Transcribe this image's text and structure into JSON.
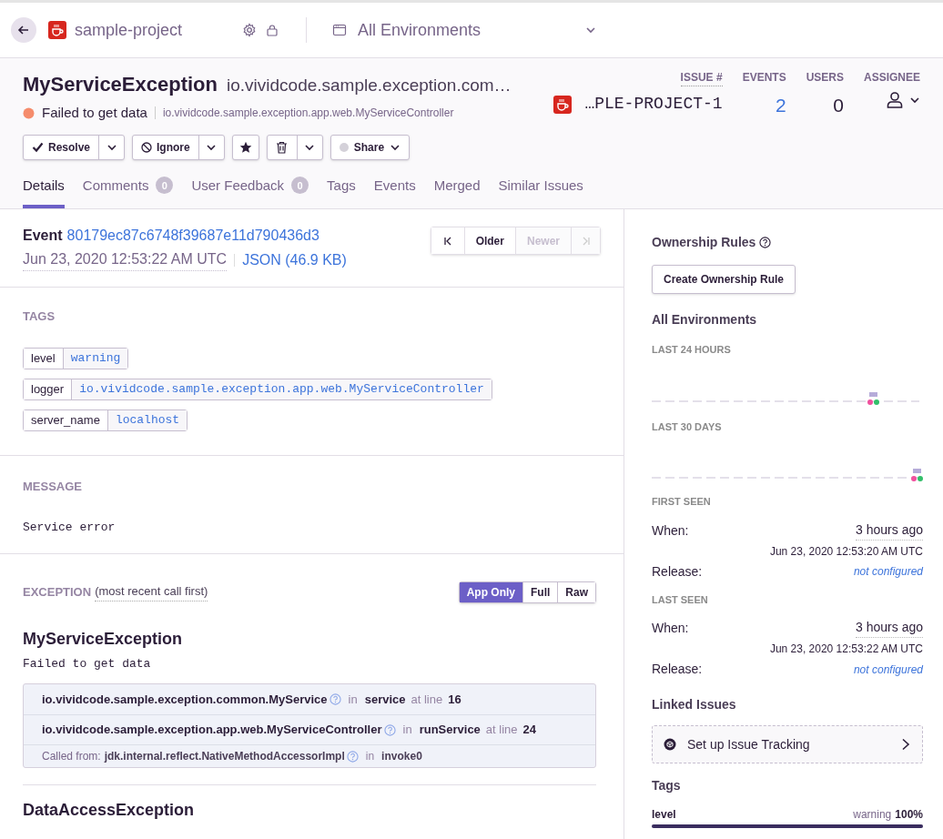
{
  "top_bar": {
    "project": "sample-project",
    "environment": "All Environments"
  },
  "issue": {
    "title": "MyServiceException",
    "culprit_heading": "io.vividcode.sample.exception.com…",
    "message": "Failed to get data",
    "culprit": "io.vividcode.sample.exception.app.web.MyServiceController"
  },
  "stats": [
    {
      "label": "ISSUE #",
      "value": "…PLE-PROJECT-1",
      "kind": "id"
    },
    {
      "label": "EVENTS",
      "value": "2",
      "kind": "link"
    },
    {
      "label": "USERS",
      "value": "0",
      "kind": "plain"
    },
    {
      "label": "ASSIGNEE",
      "kind": "assignee"
    }
  ],
  "actions": [
    {
      "kind": "resolve",
      "label": "Resolve"
    },
    {
      "kind": "ignore",
      "label": "Ignore"
    },
    {
      "kind": "bookmark"
    },
    {
      "kind": "delete"
    },
    {
      "kind": "share",
      "label": "Share"
    }
  ],
  "tabs": [
    {
      "label": "Details",
      "selected": true
    },
    {
      "label": "Comments",
      "count": "0",
      "selected": false
    },
    {
      "label": "User Feedback",
      "count": "0",
      "selected": false
    },
    {
      "label": "Tags",
      "selected": false
    },
    {
      "label": "Events",
      "selected": false
    },
    {
      "label": "Merged",
      "selected": false
    },
    {
      "label": "Similar Issues",
      "selected": false
    }
  ],
  "event": {
    "label": "Event",
    "id": "80179ec87c6748f39687e11d790436d3",
    "date": "Jun 23, 2020 12:53:22 AM UTC",
    "json": "JSON (46.9 KB)",
    "nav": [
      {
        "kind": "first",
        "disabled": false
      },
      {
        "kind": "label",
        "label": "Older",
        "disabled": false
      },
      {
        "kind": "label",
        "label": "Newer",
        "disabled": true
      },
      {
        "kind": "last",
        "disabled": true
      }
    ]
  },
  "tags": {
    "heading": "TAGS",
    "items": [
      {
        "key": "level",
        "value": "warning"
      },
      {
        "key": "logger",
        "value": "io.vividcode.sample.exception.app.web.MyServiceController"
      },
      {
        "key": "server_name",
        "value": "localhost"
      }
    ]
  },
  "message": {
    "heading": "MESSAGE",
    "text": "Service error"
  },
  "exception": {
    "heading": "EXCEPTION",
    "subheading": "(most recent call first)",
    "views": [
      {
        "label": "App Only",
        "selected": true
      },
      {
        "label": "Full",
        "selected": false
      },
      {
        "label": "Raw",
        "selected": false
      }
    ],
    "exceptions": [
      {
        "type": "MyServiceException",
        "value": "Failed to get data",
        "frames": [
          {
            "kind": "frame",
            "module": "io.vividcode.sample.exception.common.MyService",
            "in_label": "in",
            "function": "service",
            "line_label": "at line",
            "line": "16"
          },
          {
            "kind": "frame",
            "module": "io.vividcode.sample.exception.app.web.MyServiceController",
            "in_label": "in",
            "function": "runService",
            "line_label": "at line",
            "line": "24"
          },
          {
            "kind": "called_from",
            "prefix": "Called from:",
            "module": "jdk.internal.reflect.NativeMethodAccessorImpl",
            "in_label": "in",
            "function": "invoke0"
          }
        ]
      },
      {
        "type": "DataAccessException"
      }
    ]
  },
  "sidebar": {
    "ownership_heading": "Ownership Rules",
    "ownership_button": "Create Ownership Rule",
    "environment_heading": "All Environments",
    "graphs": [
      {
        "label": "LAST 24 HOURS"
      },
      {
        "label": "LAST 30 DAYS"
      }
    ],
    "seen": [
      {
        "heading": "FIRST SEEN",
        "when_label": "When:",
        "relative": "3 hours ago",
        "date": "Jun 23, 2020 12:53:20 AM UTC",
        "release_label": "Release:",
        "release": "not configured"
      },
      {
        "heading": "LAST SEEN",
        "when_label": "When:",
        "relative": "3 hours ago",
        "date": "Jun 23, 2020 12:53:22 AM UTC",
        "release_label": "Release:",
        "release": "not configured"
      }
    ],
    "linked_heading": "Linked Issues",
    "linked_button": "Set up Issue Tracking",
    "tags_heading": "Tags",
    "tag_rows": [
      {
        "key": "level",
        "value": "warning",
        "percent": "100%",
        "level": 1
      }
    ]
  }
}
